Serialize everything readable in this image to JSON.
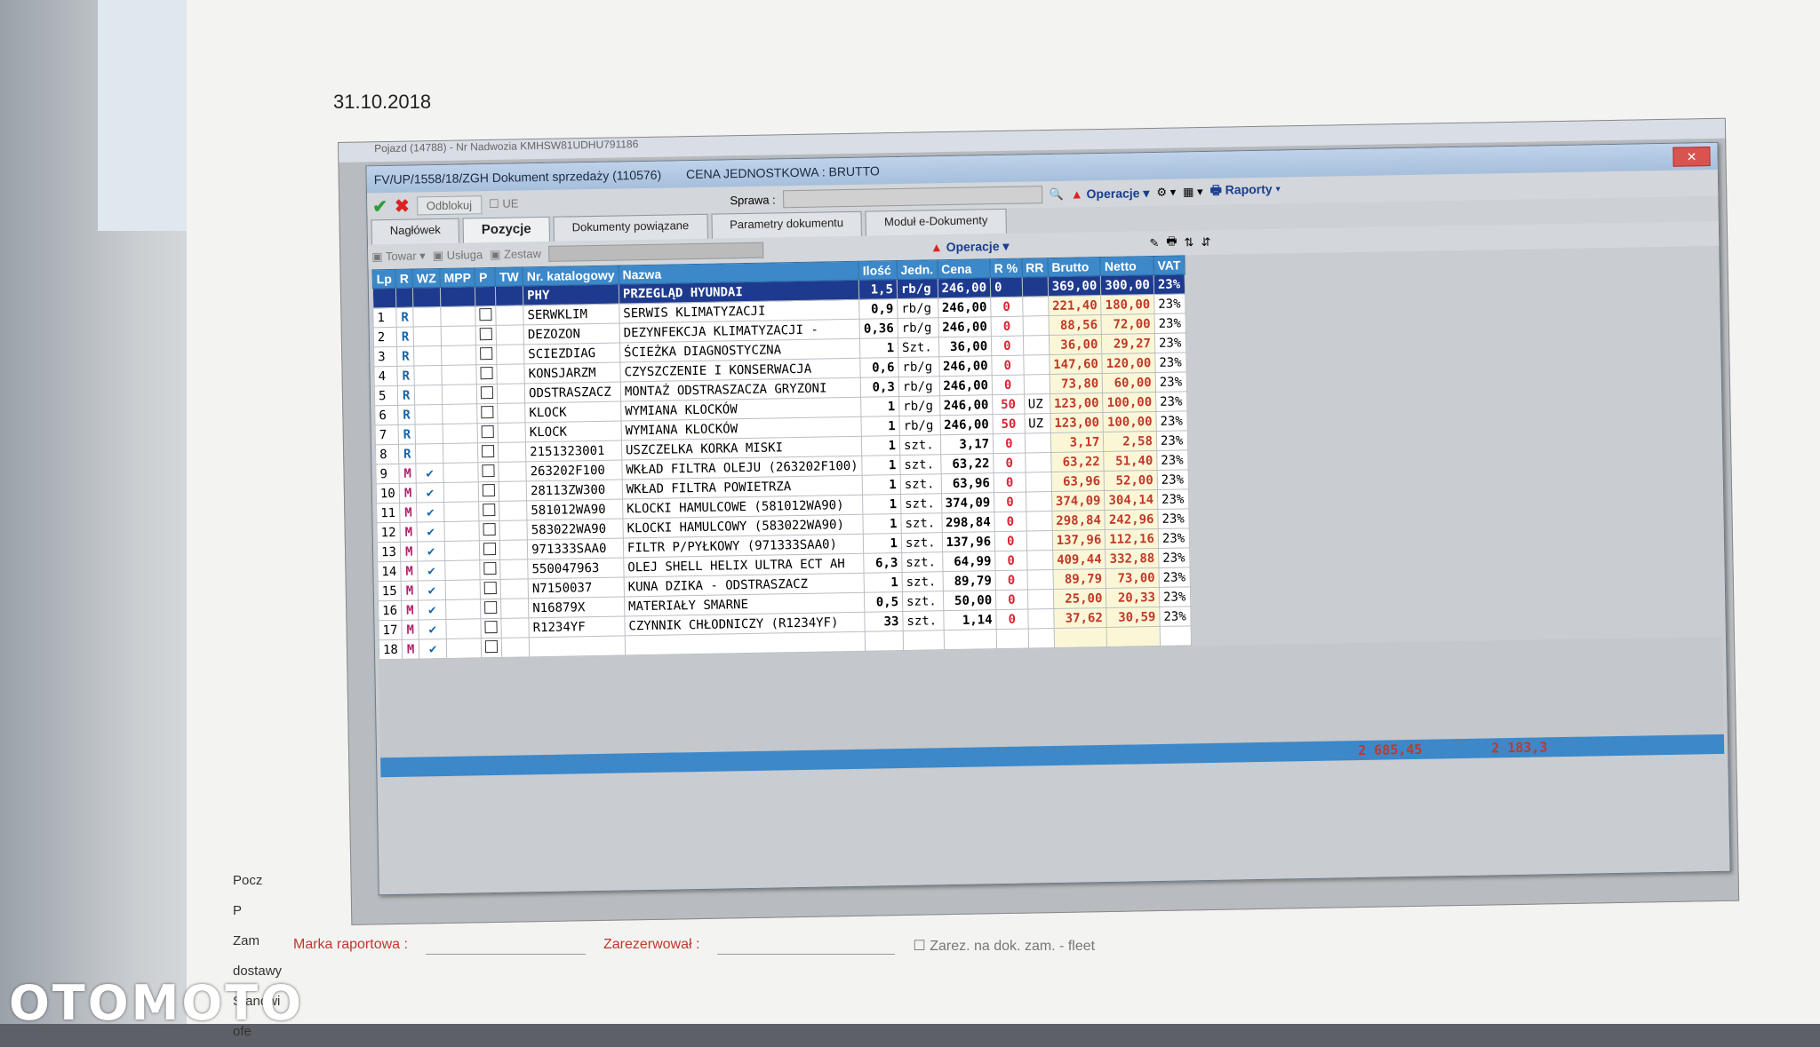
{
  "date": "31.10.2018",
  "watermark": "OTOMOTO",
  "bg_window": {
    "title": "Pojazd (14788) - Nr Nadwozia KMHSW81UDHU791186"
  },
  "doc_window": {
    "title": "FV/UP/1558/18/ZGH  Dokument sprzedaży (110576)",
    "price_mode": "CENA JEDNOSTKOWA : BRUTTO",
    "close_label": "✕"
  },
  "toolbar": {
    "unlock": "Odblokuj",
    "ue": "UE",
    "sprawa": "Sprawa :",
    "operacje": "Operacje",
    "raporty": "Raporty"
  },
  "tabs": [
    "Nagłówek",
    "Pozycje",
    "Dokumenty powiązane",
    "Parametry dokumentu",
    "Moduł e-Dokumenty"
  ],
  "toolbar2": {
    "towar": "Towar",
    "usluga": "Usługa",
    "zestaw": "Zestaw",
    "operacje": "Operacje"
  },
  "columns": [
    "Lp",
    "R",
    "WZ",
    "MPP",
    "P",
    "TW",
    "Nr. katalogowy",
    "Nazwa",
    "Ilość",
    "Jedn.",
    "Cena",
    "R %",
    "RR",
    "Brutto",
    "Netto",
    "VAT"
  ],
  "header_row": {
    "catalog": "PHY",
    "name": "PRZEGLĄD HYUNDAI",
    "qty": "1,5",
    "unit": "rb/g",
    "price": "246,00",
    "rp": "0",
    "brutto": "369,00",
    "netto": "300,00",
    "vat": "23%"
  },
  "rows": [
    {
      "lp": "1",
      "r": "R",
      "wz": "",
      "catalog": "SERWKLIM",
      "name": "SERWIS KLIMATYZACJI",
      "qty": "0,9",
      "unit": "rb/g",
      "price": "246,00",
      "rp": "0",
      "rr": "",
      "brutto": "221,40",
      "netto": "180,00",
      "vat": "23%"
    },
    {
      "lp": "2",
      "r": "R",
      "wz": "",
      "catalog": "DEZOZON",
      "name": "DEZYNFEKCJA KLIMATYZACJI -",
      "qty": "0,36",
      "unit": "rb/g",
      "price": "246,00",
      "rp": "0",
      "rr": "",
      "brutto": "88,56",
      "netto": "72,00",
      "vat": "23%"
    },
    {
      "lp": "3",
      "r": "R",
      "wz": "",
      "catalog": "SCIEZDIAG",
      "name": "ŚCIEŻKA DIAGNOSTYCZNA",
      "qty": "1",
      "unit": "Szt.",
      "price": "36,00",
      "rp": "0",
      "rr": "",
      "brutto": "36,00",
      "netto": "29,27",
      "vat": "23%"
    },
    {
      "lp": "4",
      "r": "R",
      "wz": "",
      "catalog": "KONSJARZM",
      "name": "CZYSZCZENIE I KONSERWACJA",
      "qty": "0,6",
      "unit": "rb/g",
      "price": "246,00",
      "rp": "0",
      "rr": "",
      "brutto": "147,60",
      "netto": "120,00",
      "vat": "23%"
    },
    {
      "lp": "5",
      "r": "R",
      "wz": "",
      "catalog": "ODSTRASZACZ",
      "name": "MONTAŻ ODSTRASZACZA GRYZONI",
      "qty": "0,3",
      "unit": "rb/g",
      "price": "246,00",
      "rp": "0",
      "rr": "",
      "brutto": "73,80",
      "netto": "60,00",
      "vat": "23%"
    },
    {
      "lp": "6",
      "r": "R",
      "wz": "",
      "catalog": "KLOCK",
      "name": "WYMIANA KLOCKÓW",
      "qty": "1",
      "unit": "rb/g",
      "price": "246,00",
      "rp": "50",
      "rr": "UZ",
      "brutto": "123,00",
      "netto": "100,00",
      "vat": "23%"
    },
    {
      "lp": "7",
      "r": "R",
      "wz": "",
      "catalog": "KLOCK",
      "name": "WYMIANA KLOCKÓW",
      "qty": "1",
      "unit": "rb/g",
      "price": "246,00",
      "rp": "50",
      "rr": "UZ",
      "brutto": "123,00",
      "netto": "100,00",
      "vat": "23%"
    },
    {
      "lp": "8",
      "r": "R",
      "wz": "",
      "catalog": "2151323001",
      "name": "USZCZELKA KORKA MISKI",
      "qty": "1",
      "unit": "szt.",
      "price": "3,17",
      "rp": "0",
      "rr": "",
      "brutto": "3,17",
      "netto": "2,58",
      "vat": "23%"
    },
    {
      "lp": "9",
      "r": "M",
      "wz": "✔",
      "catalog": "263202F100",
      "name": "WKŁAD FILTRA OLEJU (263202F100)",
      "qty": "1",
      "unit": "szt.",
      "price": "63,22",
      "rp": "0",
      "rr": "",
      "brutto": "63,22",
      "netto": "51,40",
      "vat": "23%"
    },
    {
      "lp": "10",
      "r": "M",
      "wz": "✔",
      "catalog": "28113ZW300",
      "name": "WKŁAD FILTRA POWIETRZA",
      "qty": "1",
      "unit": "szt.",
      "price": "63,96",
      "rp": "0",
      "rr": "",
      "brutto": "63,96",
      "netto": "52,00",
      "vat": "23%"
    },
    {
      "lp": "11",
      "r": "M",
      "wz": "✔",
      "catalog": "581012WA90",
      "name": "KLOCKI HAMULCOWE (581012WA90)",
      "qty": "1",
      "unit": "szt.",
      "price": "374,09",
      "rp": "0",
      "rr": "",
      "brutto": "374,09",
      "netto": "304,14",
      "vat": "23%"
    },
    {
      "lp": "12",
      "r": "M",
      "wz": "✔",
      "catalog": "583022WA90",
      "name": "KLOCKI HAMULCOWY (583022WA90)",
      "qty": "1",
      "unit": "szt.",
      "price": "298,84",
      "rp": "0",
      "rr": "",
      "brutto": "298,84",
      "netto": "242,96",
      "vat": "23%"
    },
    {
      "lp": "13",
      "r": "M",
      "wz": "✔",
      "catalog": "971333SAA0",
      "name": "FILTR P/PYŁKOWY (971333SAA0)",
      "qty": "1",
      "unit": "szt.",
      "price": "137,96",
      "rp": "0",
      "rr": "",
      "brutto": "137,96",
      "netto": "112,16",
      "vat": "23%"
    },
    {
      "lp": "14",
      "r": "M",
      "wz": "✔",
      "catalog": "550047963",
      "name": "OLEJ SHELL HELIX ULTRA ECT AH",
      "qty": "6,3",
      "unit": "szt.",
      "price": "64,99",
      "rp": "0",
      "rr": "",
      "brutto": "409,44",
      "netto": "332,88",
      "vat": "23%"
    },
    {
      "lp": "15",
      "r": "M",
      "wz": "✔",
      "catalog": "N7150037",
      "name": "KUNA DZIKA - ODSTRASZACZ",
      "qty": "1",
      "unit": "szt.",
      "price": "89,79",
      "rp": "0",
      "rr": "",
      "brutto": "89,79",
      "netto": "73,00",
      "vat": "23%"
    },
    {
      "lp": "16",
      "r": "M",
      "wz": "✔",
      "catalog": "N16879X",
      "name": "MATERIAŁY SMARNE",
      "qty": "0,5",
      "unit": "szt.",
      "price": "50,00",
      "rp": "0",
      "rr": "",
      "brutto": "25,00",
      "netto": "20,33",
      "vat": "23%"
    },
    {
      "lp": "17",
      "r": "M",
      "wz": "✔",
      "catalog": "R1234YF",
      "name": "CZYNNIK CHŁODNICZY (R1234YF)",
      "qty": "33",
      "unit": "szt.",
      "price": "1,14",
      "rp": "0",
      "rr": "",
      "brutto": "37,62",
      "netto": "30,59",
      "vat": "23%"
    },
    {
      "lp": "18",
      "r": "M",
      "wz": "✔",
      "catalog": "",
      "name": "",
      "qty": "",
      "unit": "",
      "price": "",
      "rp": "",
      "rr": "",
      "brutto": "",
      "netto": "",
      "vat": ""
    }
  ],
  "totals": {
    "brutto": "2 685,45",
    "netto": "2 183,3"
  },
  "footer": {
    "marka": "Marka raportowa :",
    "zarezerwowal": "Zarezerwował :",
    "zarez_fleet": "Zarez. na dok. zam. - fleet"
  },
  "left_texts": [
    "Pocz",
    "P",
    "Zam",
    "dostawy",
    "Stanowi",
    "ofe"
  ]
}
